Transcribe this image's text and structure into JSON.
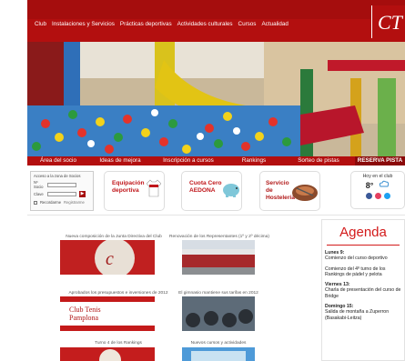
{
  "nav": {
    "items": [
      "Club",
      "Instalaciones y Servicios",
      "Prácticas deportivas",
      "Actividades culturales",
      "Cursos",
      "Actualidad"
    ]
  },
  "logo": {
    "text": "CT"
  },
  "subnav": {
    "items": [
      "Área del socio",
      "Ideas de mejora",
      "Inscripción a cursos",
      "Rankings",
      "Sorteo de pistas",
      "RESERVA PISTA"
    ]
  },
  "login": {
    "title": "Acceso a la zona de Socios",
    "socio_label": "Nº Socio",
    "clave_label": "Clave",
    "go_label": "▶",
    "remember_label": "Recordarme",
    "register_label": "Registrarme"
  },
  "promos": {
    "equipacion": "Equipación deportiva",
    "cuota": "Cuota Cero AEDONA",
    "hosteleria": "Servicio de Hostelería"
  },
  "weather": {
    "label": "Hoy en el club",
    "temp": "8°"
  },
  "news": [
    {
      "title": "Nueva composición de la Junta Directiva del Club"
    },
    {
      "title": "Renovación de los Representantes (1º y 2º décima)"
    },
    {
      "title": "Aprobados los presupuestos e inversiones de 2012",
      "banner": "Club Tenis Pamplona"
    },
    {
      "title": "El gimnasio mantiene sus tarifas en 2012"
    },
    {
      "title": "Turno 4 de los Rankings"
    },
    {
      "title": "Nuevos cursos y actividades"
    }
  ],
  "agenda": {
    "title": "Agenda",
    "items": [
      {
        "day": "Lunes 9:",
        "text": "Comienzo del curso deportivo"
      },
      {
        "day": "",
        "text": "Comienzo del 4º turno de los Rankings de pádel y pelota"
      },
      {
        "day": "Viernes 13:",
        "text": "Charla de presentación del curso de Bridge"
      },
      {
        "day": "Domingo 15:",
        "text": "Salida de montaña a Zuperron (Basakabi-Leitza)"
      }
    ]
  },
  "colors": {
    "brand_red": "#b30f0f",
    "agenda_red": "#d31a1a"
  }
}
